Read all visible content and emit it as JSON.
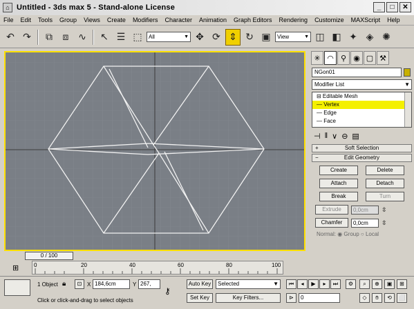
{
  "window": {
    "title": "Untitled - 3ds max 5 - Stand-alone License",
    "buttons": [
      "_",
      "□",
      "✕"
    ]
  },
  "menu": [
    "File",
    "Edit",
    "Tools",
    "Group",
    "Views",
    "Create",
    "Modifiers",
    "Character",
    "Animation",
    "Graph Editors",
    "Rendering",
    "Customize",
    "MAXScript",
    "Help"
  ],
  "toolbar": {
    "selection_filter": "All",
    "ref_coord": "View"
  },
  "viewport": {
    "label": ""
  },
  "cmdpanel": {
    "object_name": "NGon01",
    "modifier_list": "Modifier List",
    "stack": [
      {
        "label": "⊟ Editable Mesh",
        "selected": false
      },
      {
        "label": "— Vertex",
        "selected": true
      },
      {
        "label": "— Edge",
        "selected": false
      },
      {
        "label": "— Face",
        "selected": false
      }
    ],
    "soft_selection": "Soft Selection",
    "edit_geometry": "Edit Geometry",
    "buttons": {
      "create": "Create",
      "delete": "Delete",
      "attach": "Attach",
      "detach": "Detach",
      "break": "Break",
      "turn": "Turn",
      "extrude": "Extrude",
      "chamfer": "Chamfer"
    },
    "extrude_value": "0,0cm",
    "chamfer_value": "0,0cm",
    "normal_label": "Normal: ◉ Group ○ Local"
  },
  "bottom": {
    "frame_counter": "0 / 100",
    "ticks": [
      "0",
      "20",
      "40",
      "60",
      "80",
      "100"
    ],
    "selected_info": "1 Object",
    "x_label": "X",
    "x_value": "184,6cm",
    "y_label": "Y",
    "y_value": "267,",
    "prompt": "Click or click-and-drag to select objects",
    "auto_key": "Auto Key",
    "set_key": "Set Key",
    "key_mode": "Selected",
    "key_filters": "Key Filters...",
    "current_frame": "0"
  }
}
